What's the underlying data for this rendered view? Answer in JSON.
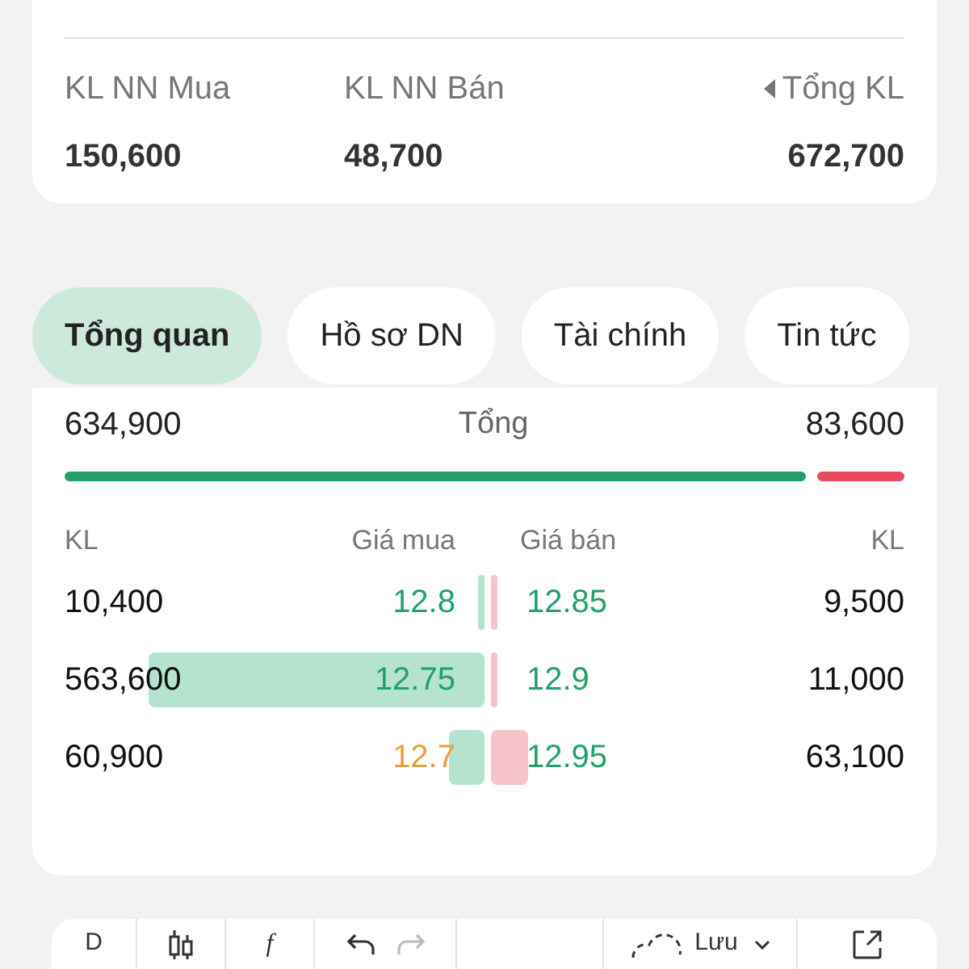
{
  "foreign_stats": [
    {
      "label": "KL NN Mua",
      "value": "150,600"
    },
    {
      "label": "KL NN Bán",
      "value": "48,700"
    },
    {
      "label": "Tổng KL",
      "value": "672,700"
    }
  ],
  "tabs": [
    {
      "label": "Tổng quan",
      "selected": true
    },
    {
      "label": "Hồ sơ DN",
      "selected": false
    },
    {
      "label": "Tài chính",
      "selected": false
    },
    {
      "label": "Tin tức",
      "selected": false
    }
  ],
  "order_book": {
    "total_buy": "634,900",
    "total_label": "Tổng",
    "total_sell": "83,600",
    "columns": [
      "KL",
      "Giá mua",
      "Giá bán",
      "KL"
    ],
    "rows": [
      {
        "bid": {
          "volume": "10,400",
          "price": "12.8",
          "color": "#22a06b"
        },
        "ask": {
          "price": "12.85",
          "color": "#22a06b",
          "volume": "9,500"
        }
      },
      {
        "bid": {
          "volume": "563,600",
          "price": "12.75",
          "color": "#22a06b"
        },
        "ask": {
          "price": "12.9",
          "color": "#22a06b",
          "volume": "11,000"
        }
      },
      {
        "bid": {
          "volume": "60,900",
          "price": "12.7",
          "color": "#e8a040"
        },
        "ask": {
          "price": "12.95",
          "color": "#22a06b",
          "volume": "63,100"
        }
      }
    ]
  },
  "toolbar": {
    "interval": "D",
    "formula": "f",
    "save": "Lưu"
  }
}
